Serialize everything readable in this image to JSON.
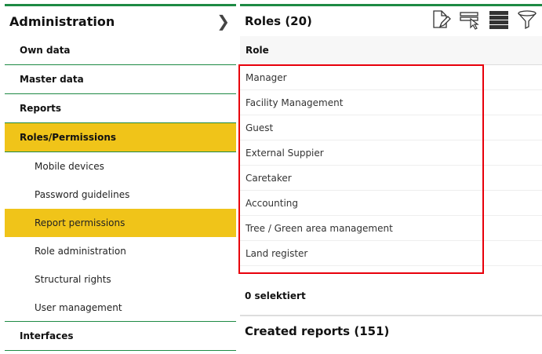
{
  "sidebar": {
    "title": "Administration",
    "items": [
      "Own data",
      "Master data",
      "Reports",
      "Roles/Permissions"
    ],
    "sub_items": [
      "Mobile devices",
      "Password guidelines",
      "Report permissions",
      "Role administration",
      "Structural rights",
      "User management"
    ],
    "bottom_item": "Interfaces"
  },
  "main": {
    "title": "Roles (20)",
    "column_header": "Role",
    "rows": [
      "Manager",
      "Facility Management",
      "Guest",
      "External Suppier",
      "Caretaker",
      "Accounting",
      "Tree / Green area management",
      "Land register"
    ],
    "selected_count": "0 selektiert",
    "created_reports": "Created reports (151)"
  }
}
